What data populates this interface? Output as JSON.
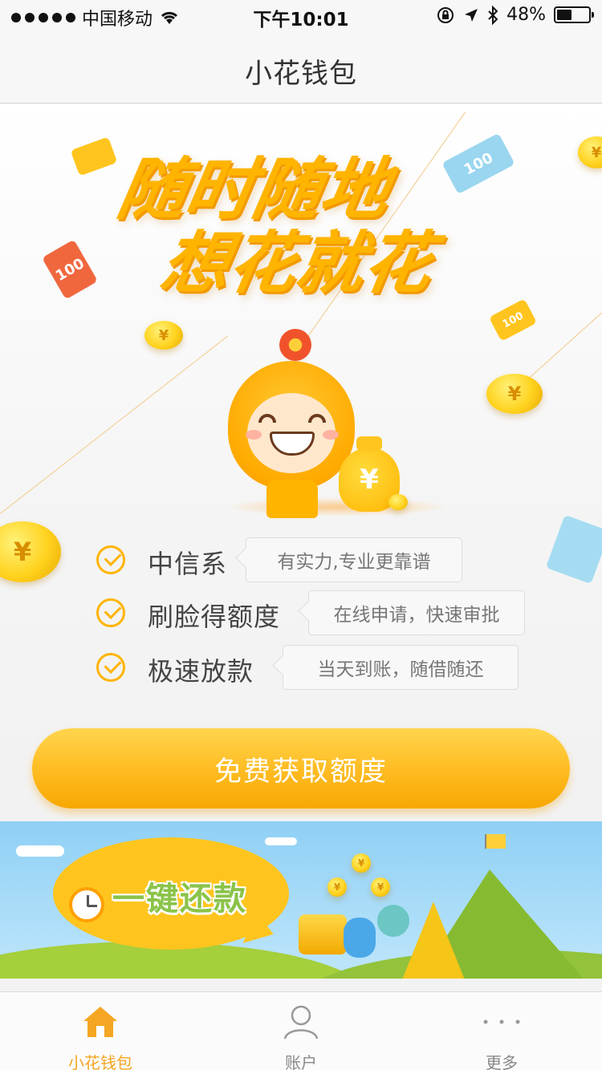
{
  "status_bar": {
    "carrier": "中国移动",
    "time": "下午10:01",
    "battery_text": "48%",
    "battery_level": 0.48
  },
  "nav": {
    "title": "小花钱包"
  },
  "hero": {
    "slogan_line1": "随时随地",
    "slogan_line2": "想花就花",
    "bill_value": "100",
    "currency_symbol": "¥"
  },
  "features": [
    {
      "label": "中信系",
      "desc": "有实力,专业更靠谱"
    },
    {
      "label": "刷脸得额度",
      "desc": "在线申请，快速审批"
    },
    {
      "label": "极速放款",
      "desc": "当天到账，随借随还"
    }
  ],
  "cta": {
    "label": "免费获取额度"
  },
  "banner": {
    "text": "一键还款"
  },
  "tabbar": {
    "items": [
      {
        "label": "小花钱包",
        "icon": "home-icon",
        "active": true
      },
      {
        "label": "账户",
        "icon": "user-icon",
        "active": false
      },
      {
        "label": "更多",
        "icon": "more-icon",
        "active": false
      }
    ]
  },
  "colors": {
    "accent": "#ffb400",
    "active_tab": "#f5a623",
    "banner_sky": "#8fd0f5",
    "banner_grass": "#a5cf3b"
  }
}
